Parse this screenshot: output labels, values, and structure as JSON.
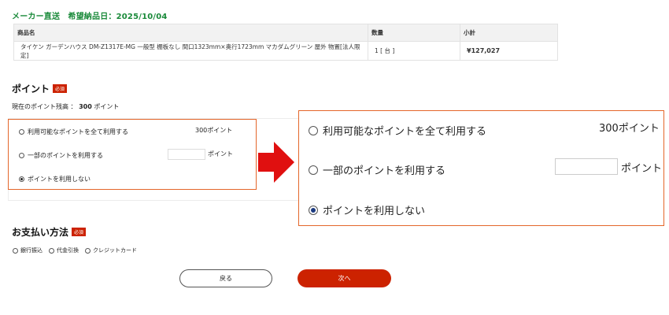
{
  "header": {
    "delivery": "メーカー直送　希望納品日：2025/10/04"
  },
  "order_table": {
    "columns": [
      "商品名",
      "数量",
      "小計"
    ],
    "rows": [
      {
        "product": "タイケン ガーデンハウス DM-Z1317E-MG 一般型 棚板なし 間口1323mm×奥行1723mm マカダムグリーン 屋外 物置[法人限定]",
        "quantity": "1 [ 台 ]",
        "subtotal": "¥127,027"
      }
    ]
  },
  "points": {
    "title": "ポイント",
    "required_badge": "必須",
    "balance_label": "現在のポイント残高 ：",
    "balance_value": "300",
    "balance_unit": "ポイント",
    "options": [
      {
        "label": "利用可能なポイントを全て利用する",
        "selected": false,
        "value_text": "300ポイント"
      },
      {
        "label": "一部のポイントを利用する",
        "selected": false,
        "input_value": "",
        "unit": "ポイント"
      },
      {
        "label": "ポイントを利用しない",
        "selected": true
      }
    ]
  },
  "payment": {
    "title": "お支払い方法",
    "required_badge": "必須",
    "options": [
      "銀行振込",
      "代金引換",
      "クレジットカード"
    ]
  },
  "buttons": {
    "back": "戻る",
    "next": "次へ"
  },
  "colors": {
    "accent_green": "#1a8a3a",
    "required_red": "#cc2200",
    "highlight_orange": "#e4662a",
    "next_button": "#cc2200"
  },
  "icons": [
    "radio-unselected-icon",
    "radio-selected-icon",
    "right-arrow-icon"
  ]
}
